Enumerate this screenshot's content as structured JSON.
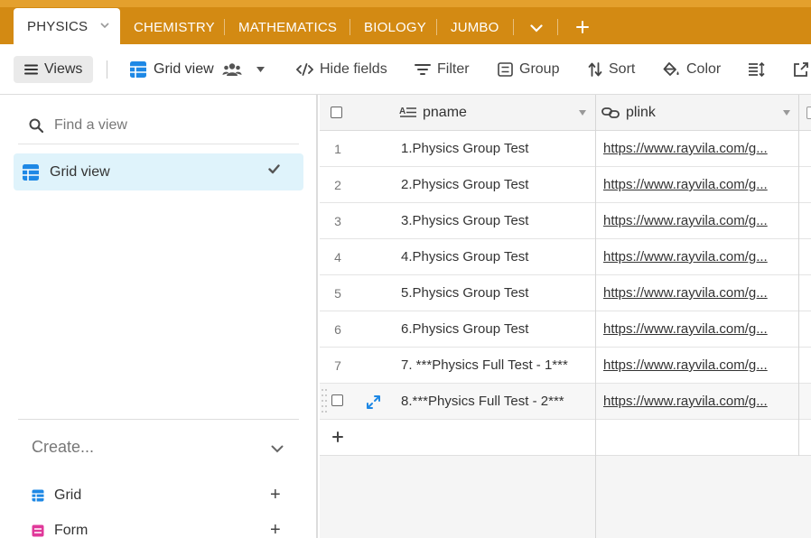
{
  "tabs": {
    "active": "PHYSICS",
    "items": [
      "CHEMISTRY",
      "MATHEMATICS",
      "BIOLOGY",
      "JUMBO"
    ]
  },
  "toolbar": {
    "views": "Views",
    "view_name": "Grid view",
    "hide_fields": "Hide fields",
    "filter": "Filter",
    "group": "Group",
    "sort": "Sort",
    "color": "Color"
  },
  "sidebar": {
    "search_placeholder": "Find a view",
    "current_view": "Grid view",
    "create_label": "Create...",
    "create_items": [
      {
        "label": "Grid",
        "icon": "grid-icon",
        "color": "#1e88e5"
      },
      {
        "label": "Form",
        "icon": "form-icon",
        "color": "#e0399a"
      }
    ]
  },
  "grid": {
    "columns": [
      {
        "name": "pname",
        "icon": "long-text-icon"
      },
      {
        "name": "plink",
        "icon": "link-icon"
      }
    ],
    "rows": [
      {
        "num": "1",
        "pname": "1.Physics Group Test",
        "plink": "https://www.rayvila.com/g..."
      },
      {
        "num": "2",
        "pname": "2.Physics Group Test",
        "plink": "https://www.rayvila.com/g..."
      },
      {
        "num": "3",
        "pname": "3.Physics Group Test",
        "plink": "https://www.rayvila.com/g..."
      },
      {
        "num": "4",
        "pname": "4.Physics Group Test",
        "plink": "https://www.rayvila.com/g..."
      },
      {
        "num": "5",
        "pname": "5.Physics Group Test",
        "plink": "https://www.rayvila.com/g..."
      },
      {
        "num": "6",
        "pname": "6.Physics Group Test",
        "plink": "https://www.rayvila.com/g..."
      },
      {
        "num": "7",
        "pname": "7. ***Physics Full Test - 1***",
        "plink": "https://www.rayvila.com/g..."
      },
      {
        "num": "",
        "pname": "8.***Physics Full Test - 2***",
        "plink": "https://www.rayvila.com/g..."
      }
    ]
  },
  "colors": {
    "tab_bar": "#d38a13",
    "accent_blue": "#1e88e5",
    "selected_view_bg": "#dff3fb"
  }
}
